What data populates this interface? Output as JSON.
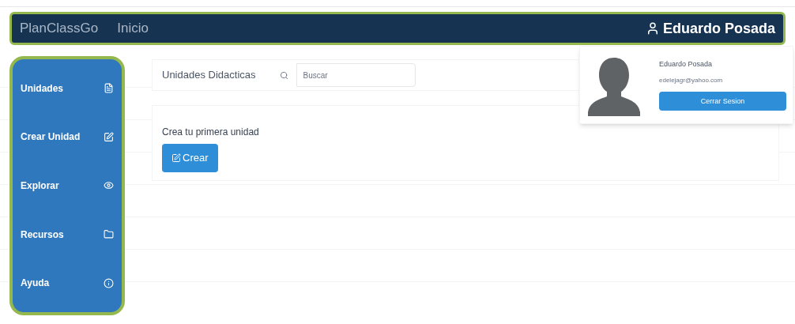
{
  "navbar": {
    "brand": "PlanClassGo",
    "links": [
      "Inicio"
    ],
    "user": "Eduardo Posada"
  },
  "sidebar": {
    "items": [
      {
        "label": "Unidades",
        "kind": "file"
      },
      {
        "label": "Crear Unidad",
        "kind": "edit"
      },
      {
        "label": "Explorar",
        "kind": "eye"
      },
      {
        "label": "Recursos",
        "kind": "folder"
      },
      {
        "label": "Ayuda",
        "kind": "info"
      }
    ]
  },
  "header": {
    "title": "Unidades Didacticas",
    "search": {
      "placeholder": "Buscar"
    }
  },
  "empty_card": {
    "message": "Crea tu primera unidad",
    "button": "Crear"
  },
  "user_menu": {
    "name": "Eduardo Posada",
    "email": "edelejagr@yahoo.com",
    "button": "Cerrar Sesion"
  }
}
